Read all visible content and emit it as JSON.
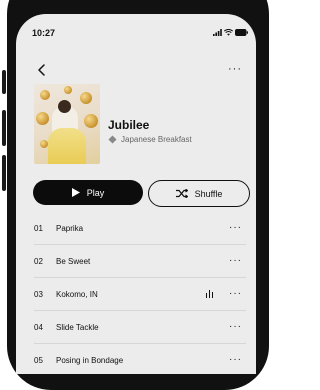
{
  "status": {
    "time": "10:27"
  },
  "album": {
    "title": "Jubilee",
    "artist": "Japanese Breakfast",
    "artwork_icon": "album-artwork"
  },
  "controls": {
    "play_label": "Play",
    "shuffle_label": "Shuffle"
  },
  "tracks": [
    {
      "num": "01",
      "title": "Paprika",
      "playing": false
    },
    {
      "num": "02",
      "title": "Be Sweet",
      "playing": false
    },
    {
      "num": "03",
      "title": "Kokomo, IN",
      "playing": true
    },
    {
      "num": "04",
      "title": "Slide Tackle",
      "playing": false
    },
    {
      "num": "05",
      "title": "Posing in Bondage",
      "playing": false
    }
  ],
  "colors": {
    "accent": "#0c0c0c",
    "screen_bg": "#ececec",
    "divider": "#d6d6d6"
  }
}
